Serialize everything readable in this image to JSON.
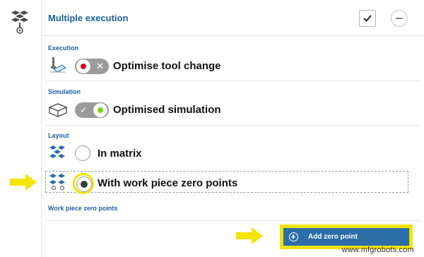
{
  "header": {
    "title": "Multiple execution"
  },
  "sections": {
    "execution": {
      "label": "Execution",
      "option_label": "Optimise tool change",
      "toggle_state": "off"
    },
    "simulation": {
      "label": "Simulation",
      "option_label": "Optimised simulation",
      "toggle_state": "on"
    },
    "layout": {
      "label": "Layout",
      "options": [
        {
          "label": "In matrix",
          "selected": false
        },
        {
          "label": "With work piece zero points",
          "selected": true
        }
      ]
    },
    "zero_points": {
      "label": "Work piece zero points"
    }
  },
  "add_button": {
    "label": "Add zero point"
  },
  "watermark": "www.mfgrobots.com",
  "colors": {
    "accent": "#1d5fa0",
    "button": "#2b6ea8",
    "highlight": "#f2e200",
    "toggle_off_dot": "#d0021b",
    "toggle_on_dot": "#7ed321"
  },
  "icons": {
    "rail": "multiple-execution-icon",
    "execution": "tool-change-icon",
    "simulation": "simulation-box-icon",
    "layout_matrix": "matrix-layout-icon",
    "layout_zero": "zero-points-layout-icon"
  }
}
